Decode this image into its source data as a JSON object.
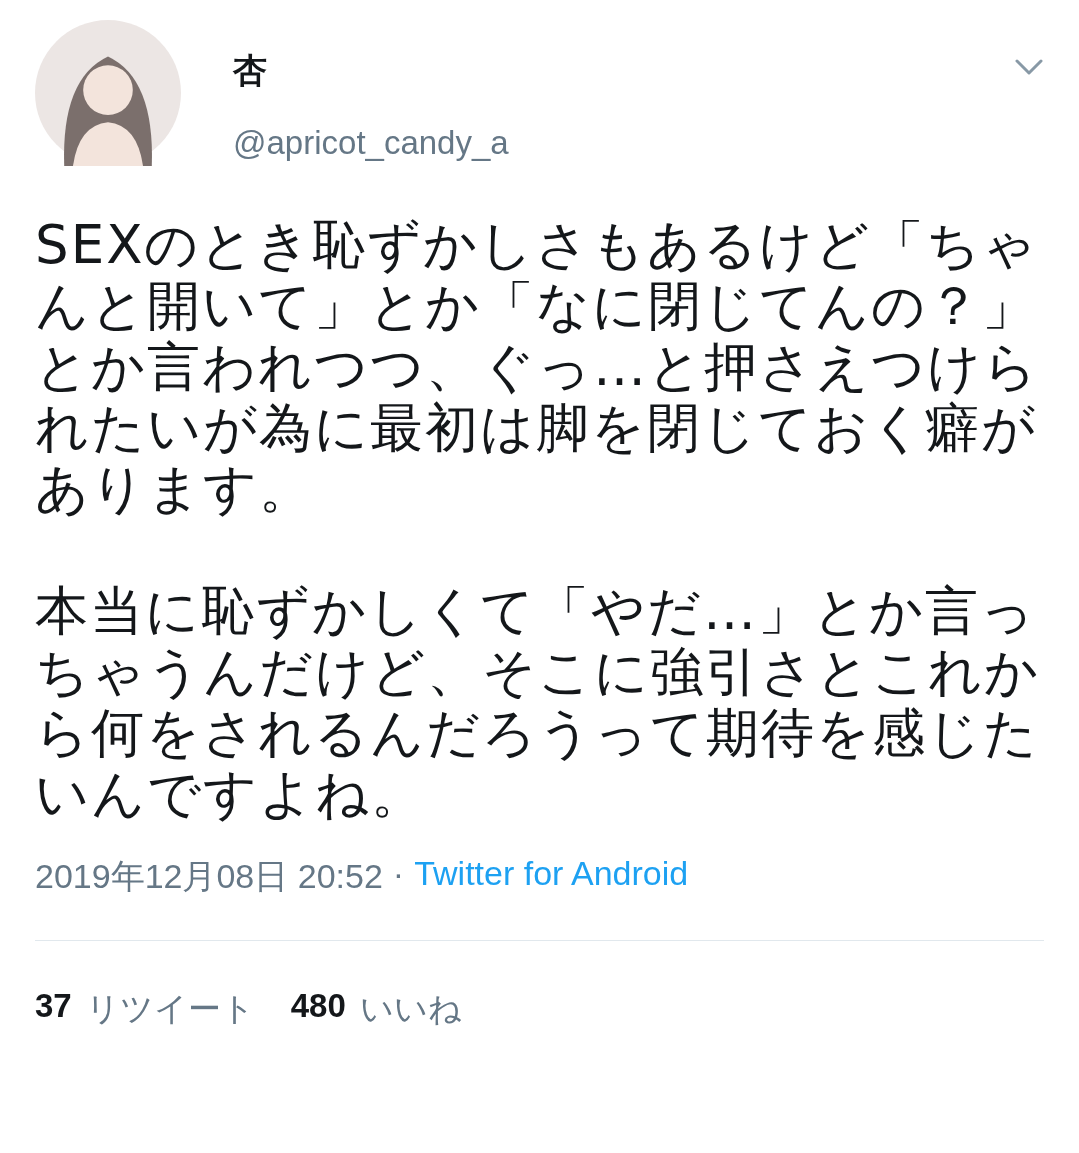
{
  "author": {
    "name": "杏",
    "handle": "@apricot_candy_a"
  },
  "body": [
    "SEXのとき恥ずかしさもあるけど「ちゃんと開いて」とか「なに閉じてんの？」とか言われつつ、ぐっ…と押さえつけられたいが為に最初は脚を閉じておく癖があります。",
    "本当に恥ずかしくて「やだ…」とか言っちゃうんだけど、そこに強引さとこれから何をされるんだろうって期待を感じたいんですよね。"
  ],
  "meta": {
    "timestamp": "2019年12月08日 20:52",
    "separator": "·",
    "source": "Twitter for Android"
  },
  "stats": [
    {
      "count": "37",
      "label": "リツイート"
    },
    {
      "count": "480",
      "label": "いいね"
    }
  ]
}
